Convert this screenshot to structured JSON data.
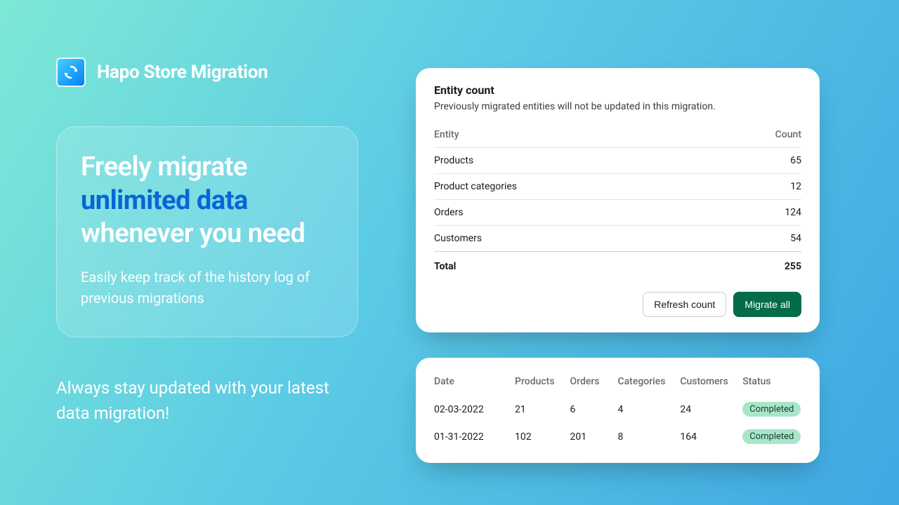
{
  "brand": {
    "title": "Hapo Store Migration"
  },
  "hero": {
    "line1": "Freely migrate",
    "accent": "unlimited data",
    "line3": "whenever you need",
    "subtitle": "Easily keep track of the history log of previous migrations"
  },
  "tagline": "Always stay updated with your latest data migration!",
  "entity_card": {
    "title": "Entity count",
    "note": "Previously migrated entities will not be updated in this migration.",
    "col_entity": "Entity",
    "col_count": "Count",
    "rows": [
      {
        "label": "Products",
        "count": "65"
      },
      {
        "label": "Product categories",
        "count": "12"
      },
      {
        "label": "Orders",
        "count": "124"
      },
      {
        "label": "Customers",
        "count": "54"
      }
    ],
    "total_label": "Total",
    "total_count": "255",
    "refresh_label": "Refresh count",
    "migrate_label": "Migrate all"
  },
  "history_card": {
    "columns": {
      "date": "Date",
      "products": "Products",
      "orders": "Orders",
      "categories": "Categories",
      "customers": "Customers",
      "status": "Status"
    },
    "rows": [
      {
        "date": "02-03-2022",
        "products": "21",
        "orders": "6",
        "categories": "4",
        "customers": "24",
        "status": "Completed"
      },
      {
        "date": "01-31-2022",
        "products": "102",
        "orders": "201",
        "categories": "8",
        "customers": "164",
        "status": "Completed"
      }
    ]
  }
}
